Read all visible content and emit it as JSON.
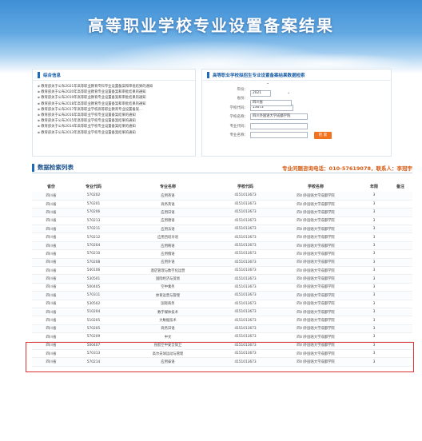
{
  "header": {
    "title": "高等职业学校专业设置备案结果"
  },
  "left_panel": {
    "title": "综合信息",
    "news": [
      "教育部关于公布2021年高等职业教育专科专业设置备案和审批结果的通知",
      "教育部关于公布2020年高等职业教育专业设置备案和审批结果的通知",
      "教育部关于公布2019年高等职业教育专业设置备案和审批结果的通知",
      "教育部关于公布2018年高等职业教育专业设置备案和审批结果的通知",
      "教育部关于公布2017年高等职业学校高等职业教育专业设置备案...",
      "教育部关于公布2016年高等职业学校专业设置备案结果的通知",
      "教育部关于公布2015年高等职业学校专业设置备案结果的通知",
      "教育部关于公布2014年高等职业学校专业设置备案结果的通知",
      "教育部关于公布2013年高等职业学校专业设置备案结果的通知"
    ]
  },
  "right_panel": {
    "title": "高等职业学校拟招生专业设置备案结果数据检索",
    "fields": {
      "year_label": "年份：",
      "year_value": "2021",
      "province_label": "省份：",
      "province_value": "四川省",
      "school_code_label": "学校代码：",
      "school_code_value": "13673",
      "school_name_label": "学校名称：",
      "school_name_value": "四川外国语大学成都学院",
      "major_code_label": "专业代码：",
      "major_code_value": "",
      "major_name_label": "专业名称：",
      "major_name_value": ""
    },
    "search_button": "检 索"
  },
  "list": {
    "title": "数据检索列表",
    "hotline": "专业问题咨询电话：010-57619078，联系人：李冠宇",
    "headers": [
      "省份",
      "专业代码",
      "专业名称",
      "学校代码",
      "学校名称",
      "年限",
      "备注"
    ],
    "rows": [
      [
        "四川省",
        "570202",
        "应用英语",
        "4151013673",
        "四川外国语大学成都学院",
        "3",
        ""
      ],
      [
        "四川省",
        "570201",
        "商务英语",
        "4151013673",
        "四川外国语大学成都学院",
        "3",
        ""
      ],
      [
        "四川省",
        "570206",
        "应用日语",
        "4151013673",
        "四川外国语大学成都学院",
        "3",
        ""
      ],
      [
        "四川省",
        "570213",
        "应用德语",
        "4151013673",
        "四川外国语大学成都学院",
        "3",
        ""
      ],
      [
        "四川省",
        "570211",
        "应用法语",
        "4151013673",
        "四川外国语大学成都学院",
        "3",
        ""
      ],
      [
        "四川省",
        "570212",
        "应用西班牙语",
        "4151013673",
        "四川外国语大学成都学院",
        "3",
        ""
      ],
      [
        "四川省",
        "570204",
        "应用韩语",
        "4151013673",
        "四川外国语大学成都学院",
        "3",
        ""
      ],
      [
        "四川省",
        "570210",
        "应用俄语",
        "4151013673",
        "四川外国语大学成都学院",
        "3",
        ""
      ],
      [
        "四川省",
        "570208",
        "应用外语",
        "4151013673",
        "四川外国语大学成都学院",
        "3",
        ""
      ],
      [
        "四川省",
        "540106",
        "酒店管理与数字化运营",
        "4151013673",
        "四川外国语大学成都学院",
        "3",
        ""
      ],
      [
        "四川省",
        "530501",
        "国际经济与贸易",
        "4151013673",
        "四川外国语大学成都学院",
        "3",
        ""
      ],
      [
        "四川省",
        "500405",
        "空中乘务",
        "4151013673",
        "四川外国语大学成都学院",
        "3",
        ""
      ],
      [
        "四川省",
        "570311",
        "体育运营与管理",
        "4151013673",
        "四川外国语大学成都学院",
        "3",
        ""
      ],
      [
        "四川省",
        "530502",
        "国际商务",
        "4151013673",
        "四川外国语大学成都学院",
        "3",
        ""
      ],
      [
        "四川省",
        "510204",
        "数字媒体技术",
        "4151013673",
        "四川外国语大学成都学院",
        "3",
        ""
      ],
      [
        "四川省",
        "510205",
        "大数据技术",
        "4151013673",
        "四川外国语大学成都学院",
        "3",
        ""
      ],
      [
        "四川省",
        "570205",
        "商务日语",
        "4151013673",
        "四川外国语大学成都学院",
        "3",
        ""
      ],
      [
        "四川省",
        "570209",
        "中文",
        "4151013673",
        "四川外国语大学成都学院",
        "3",
        ""
      ],
      [
        "四川省",
        "500407",
        "民航空中安全保卫",
        "4151013673",
        "四川外国语大学成都学院",
        "3",
        ""
      ],
      [
        "四川省",
        "570313",
        "高尔夫球运动与管理",
        "4151013673",
        "四川外国语大学成都学院",
        "3",
        ""
      ],
      [
        "四川省",
        "570214",
        "应用泰语",
        "4151013673",
        "四川外国语大学成都学院",
        "3",
        ""
      ]
    ]
  },
  "colors": {
    "banner": "#3f8fd6",
    "accent": "#1a6ac0",
    "button": "#f1731f",
    "hotline": "#d45a12",
    "highlight": "#e03030"
  }
}
